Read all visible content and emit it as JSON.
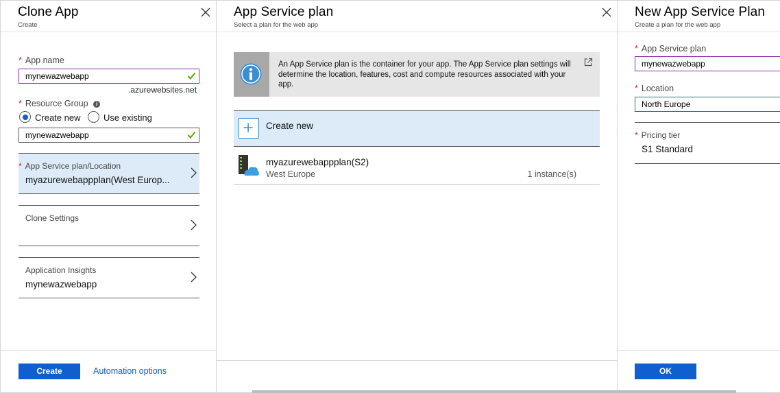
{
  "clone_app": {
    "title": "Clone App",
    "subtitle": "Create",
    "app_name": {
      "label": "App name",
      "value": "mynewazwebapp",
      "suffix": ".azurewebsites.net"
    },
    "resource_group": {
      "label": "Resource Group",
      "options": [
        "Create new",
        "Use existing"
      ],
      "selected": "Create new",
      "value": "mynewazwebapp"
    },
    "nav_items": [
      {
        "label": "App Service plan/Location",
        "value": "myazurewebappplan(West Europ...",
        "required": true,
        "selected": true
      },
      {
        "label": "Clone Settings",
        "value": "",
        "required": false,
        "selected": false
      },
      {
        "label": "Application Insights",
        "value": "mynewazwebapp",
        "required": false,
        "selected": false
      }
    ],
    "create_button": "Create",
    "automation_link": "Automation options"
  },
  "app_service_plan": {
    "title": "App Service plan",
    "subtitle": "Select a plan for the web app",
    "info_text": "An App Service plan is the container for your app. The App Service plan settings will determine the location, features, cost and compute resources associated with your app.",
    "create_new_label": "Create new",
    "plans": [
      {
        "name": "myazurewebappplan(S2)",
        "region": "West Europe",
        "instances": "1 instance(s)"
      }
    ]
  },
  "new_plan": {
    "title": "New App Service Plan",
    "subtitle": "Create a plan for the web app",
    "plan_field": {
      "label": "App Service plan",
      "value": "mynewazwebapp"
    },
    "location_field": {
      "label": "Location",
      "value": "North Europe"
    },
    "pricing_tier": {
      "label": "Pricing tier",
      "value": "S1 Standard"
    },
    "ok_button": "OK"
  },
  "icons": {
    "close": "close-icon",
    "check": "checkmark-icon",
    "info": "info-icon",
    "external": "external-link-icon",
    "chevron": "chevron-right-icon",
    "plus": "plus-icon",
    "plan": "app-service-plan-icon"
  },
  "colors": {
    "accent": "#0f5fd0",
    "selected_bg": "#dcebf7",
    "required": "#c8252a",
    "valid_check": "#5aa700",
    "focus_border": "#8a2aa9"
  }
}
